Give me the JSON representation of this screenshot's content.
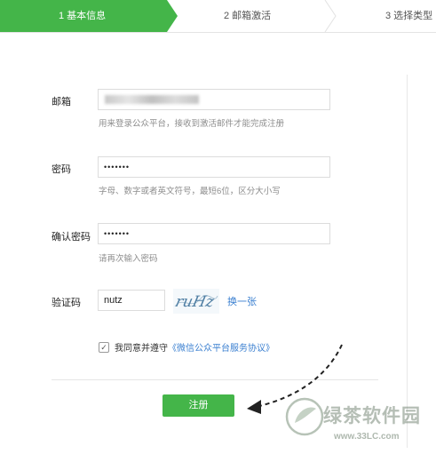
{
  "steps": [
    {
      "label": "1 基本信息",
      "active": true
    },
    {
      "label": "2 邮箱激活",
      "active": false
    },
    {
      "label": "3 选择类型",
      "active": false
    }
  ],
  "form": {
    "email": {
      "label": "邮箱",
      "hint": "用来登录公众平台，接收到激活邮件才能完成注册"
    },
    "password": {
      "label": "密码",
      "value": "•••••••",
      "hint": "字母、数字或者英文符号，最短6位，区分大小写"
    },
    "confirm": {
      "label": "确认密码",
      "value": "•••••••",
      "hint": "请再次输入密码"
    },
    "captcha": {
      "label": "验证码",
      "value": "nutz",
      "image_text": "ruHz",
      "refresh": "换一张"
    },
    "agree": {
      "prefix": "我同意并遵守",
      "link": "《微信公众平台服务协议》",
      "checked": true
    },
    "submit": "注册"
  },
  "watermark": {
    "text": "绿茶软件园",
    "url": "www.33LC.com"
  },
  "colors": {
    "accent": "#44b549",
    "link": "#3a7fd0"
  }
}
